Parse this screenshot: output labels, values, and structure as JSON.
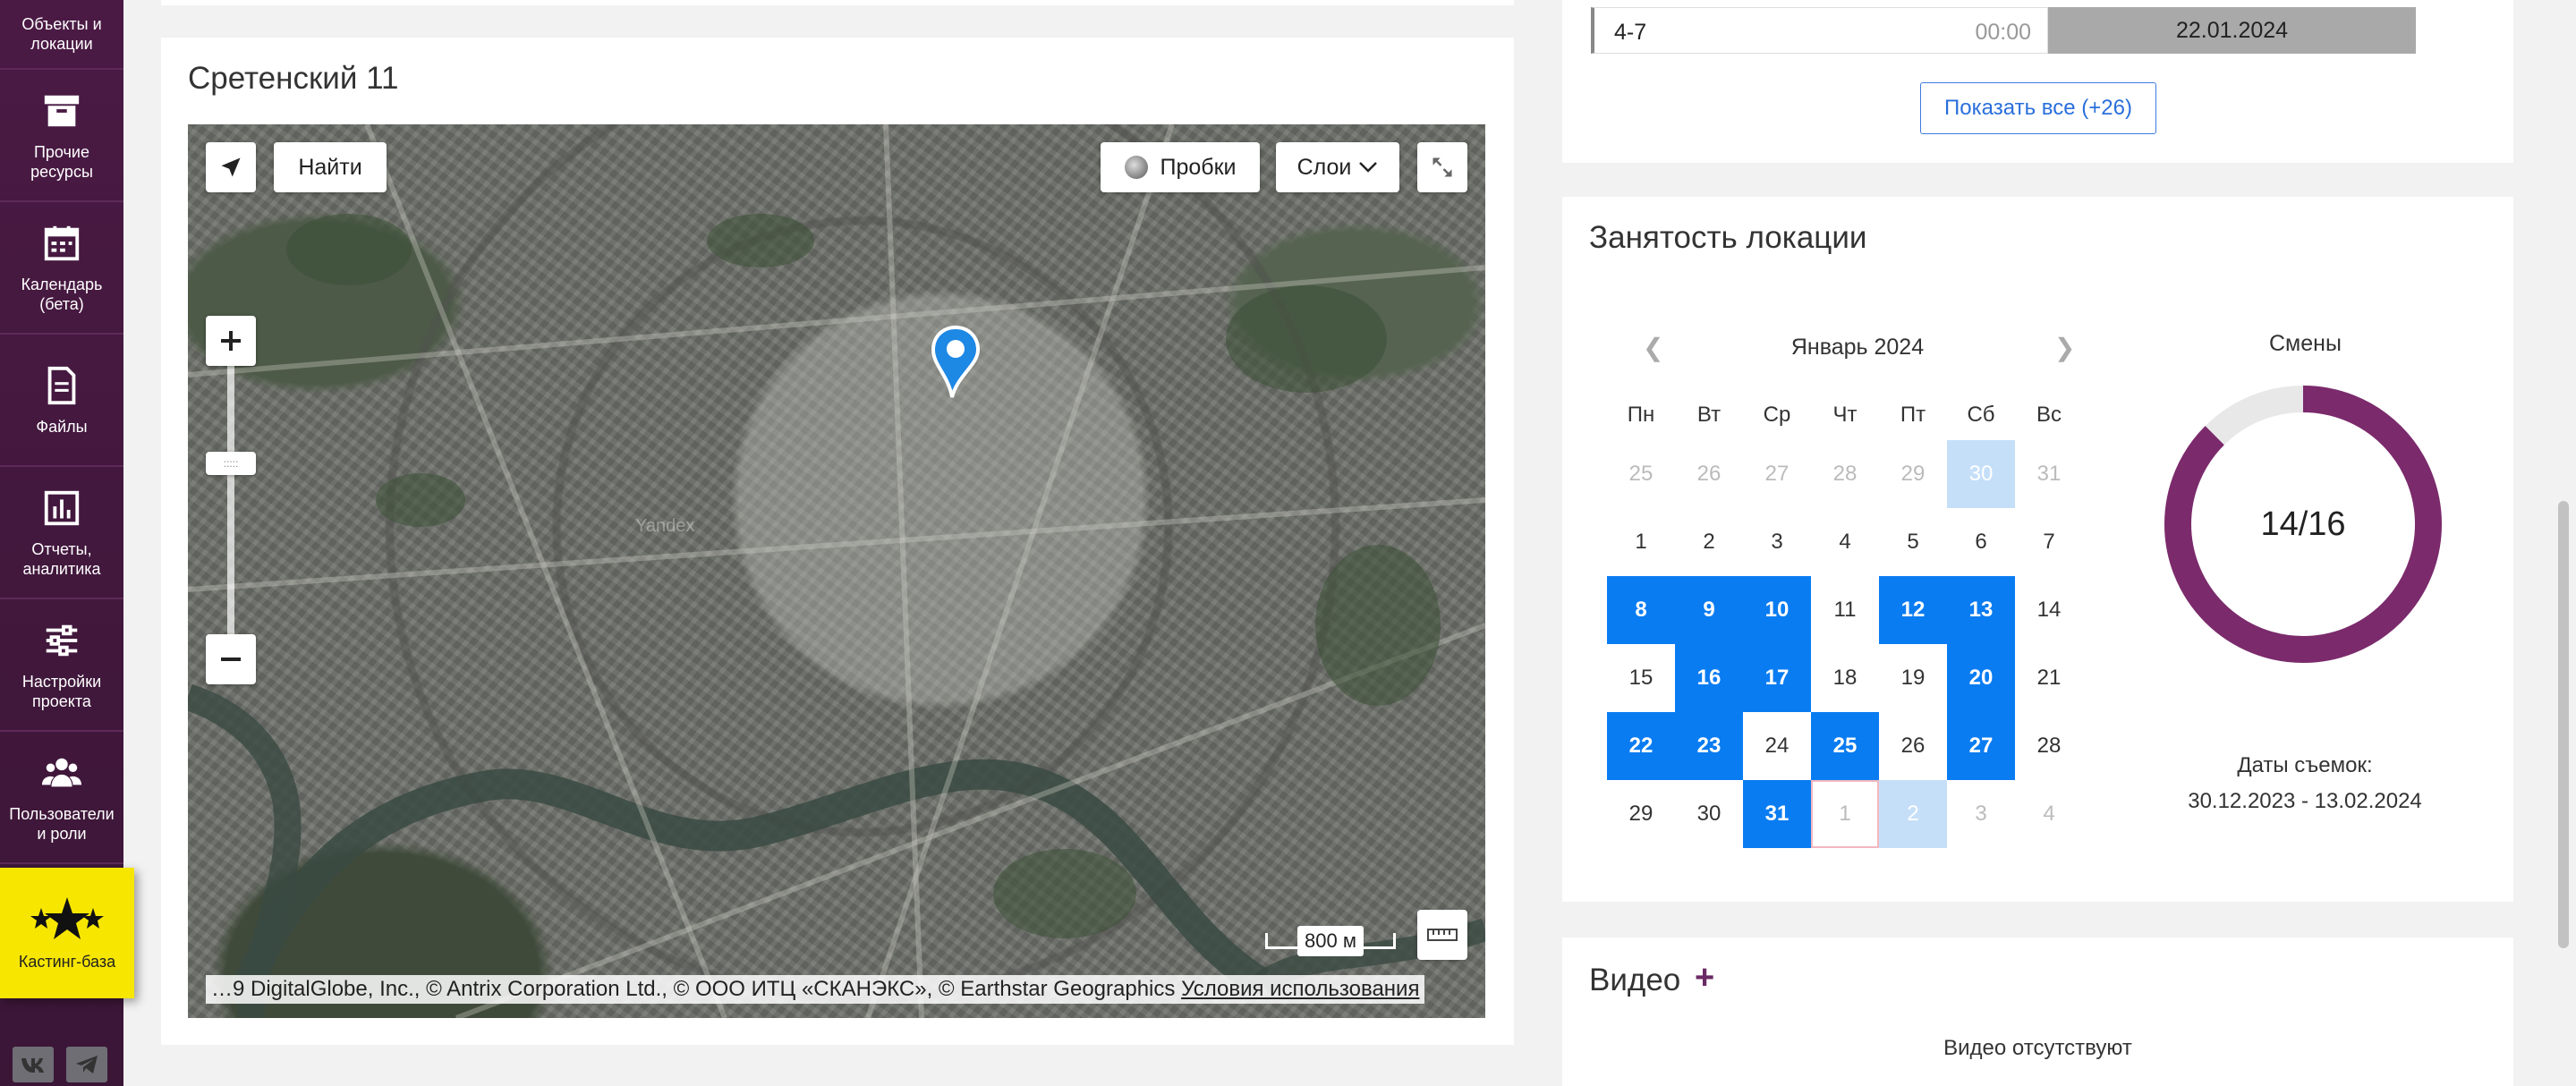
{
  "sidebar": {
    "top_item": "Объекты и локации",
    "items": [
      {
        "label": "Прочие ресурсы",
        "icon": "archive-icon"
      },
      {
        "label": "Календарь (бета)",
        "icon": "calendar-icon"
      },
      {
        "label": "Файлы",
        "icon": "file-icon"
      },
      {
        "label": "Отчеты, аналитика",
        "icon": "bar-chart-icon"
      },
      {
        "label": "Настройки проекта",
        "icon": "sliders-icon"
      },
      {
        "label": "Пользователи и роли",
        "icon": "users-icon"
      }
    ],
    "casting": {
      "label": "Кастинг-база",
      "icon": "stars-icon"
    },
    "socials": [
      "vk-icon",
      "telegram-icon"
    ]
  },
  "map_card": {
    "title": "Сретенский 11",
    "find_label": "Найти",
    "traffic_label": "Пробки",
    "layers_label": "Слои",
    "scale_label": "800 м",
    "watermark": "Yandex",
    "copyright": "…9 DigitalGlobe, Inc., © Antrix Corporation Ltd., © ООО ИТЦ «СКАНЭКС», © Earthstar Geographics",
    "terms_link": "Условия использования"
  },
  "schedule": {
    "name": "4-7",
    "time": "00:00",
    "date": "22.01.2024",
    "show_all": "Показать все (+26)"
  },
  "occupancy": {
    "title": "Занятость локации",
    "month": "Январь 2024",
    "weekdays": [
      "Пн",
      "Вт",
      "Ср",
      "Чт",
      "Пт",
      "Сб",
      "Вс"
    ],
    "weeks": [
      [
        {
          "d": "25",
          "s": "muted"
        },
        {
          "d": "26",
          "s": "muted"
        },
        {
          "d": "27",
          "s": "muted"
        },
        {
          "d": "28",
          "s": "muted"
        },
        {
          "d": "29",
          "s": "muted"
        },
        {
          "d": "30",
          "s": "light"
        },
        {
          "d": "31",
          "s": "muted"
        }
      ],
      [
        {
          "d": "1",
          "s": ""
        },
        {
          "d": "2",
          "s": ""
        },
        {
          "d": "3",
          "s": ""
        },
        {
          "d": "4",
          "s": ""
        },
        {
          "d": "5",
          "s": ""
        },
        {
          "d": "6",
          "s": ""
        },
        {
          "d": "7",
          "s": ""
        }
      ],
      [
        {
          "d": "8",
          "s": "busy"
        },
        {
          "d": "9",
          "s": "busy"
        },
        {
          "d": "10",
          "s": "busy"
        },
        {
          "d": "11",
          "s": ""
        },
        {
          "d": "12",
          "s": "busy"
        },
        {
          "d": "13",
          "s": "busy"
        },
        {
          "d": "14",
          "s": ""
        }
      ],
      [
        {
          "d": "15",
          "s": ""
        },
        {
          "d": "16",
          "s": "busy"
        },
        {
          "d": "17",
          "s": "busy"
        },
        {
          "d": "18",
          "s": ""
        },
        {
          "d": "19",
          "s": ""
        },
        {
          "d": "20",
          "s": "busy"
        },
        {
          "d": "21",
          "s": ""
        }
      ],
      [
        {
          "d": "22",
          "s": "busy"
        },
        {
          "d": "23",
          "s": "busy"
        },
        {
          "d": "24",
          "s": ""
        },
        {
          "d": "25",
          "s": "busy"
        },
        {
          "d": "26",
          "s": ""
        },
        {
          "d": "27",
          "s": "busy"
        },
        {
          "d": "28",
          "s": ""
        }
      ],
      [
        {
          "d": "29",
          "s": ""
        },
        {
          "d": "30",
          "s": ""
        },
        {
          "d": "31",
          "s": "busy"
        },
        {
          "d": "1",
          "s": "today"
        },
        {
          "d": "2",
          "s": "light"
        },
        {
          "d": "3",
          "s": "muted"
        },
        {
          "d": "4",
          "s": "muted"
        }
      ]
    ],
    "shifts_label": "Смены",
    "shifts_done": 14,
    "shifts_total": 16,
    "shifts_text": "14/16",
    "dates_label": "Даты съемок:",
    "dates_range": "30.12.2023 - 13.02.2024",
    "colors": {
      "busy": "#0a7cf2",
      "light": "#c6dff9",
      "donut": "#7b2a6c",
      "donut_bg": "#e8e8e8"
    }
  },
  "video": {
    "title": "Видео",
    "add": "+",
    "empty": "Видео отсутствуют"
  }
}
